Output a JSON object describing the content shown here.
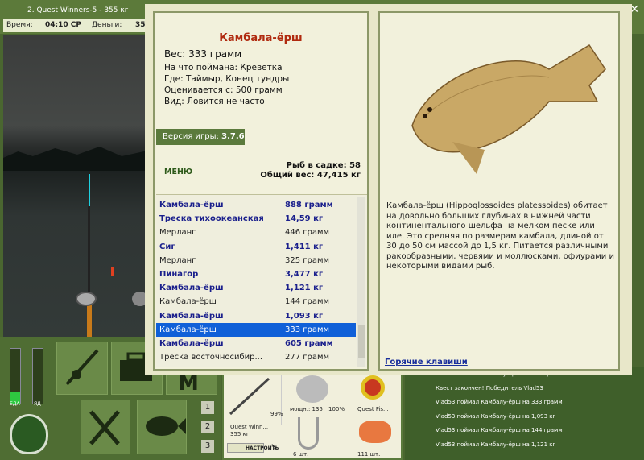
{
  "window_title": "2. Quest Winners-5 - 355 кг",
  "status": {
    "time_label": "Время:",
    "time_value": "04:10 СР",
    "money_label": "Деньги:",
    "money_value": "35"
  },
  "close_icon": "close-icon",
  "fish_card": {
    "name": "Камбала-ёрш",
    "weight": "Вес: 333 грамм",
    "caught_on": "На что поймана: Креветка",
    "where": "Где: Таймыр, Конец тундры",
    "value": "Оценивается с: 500 грамм",
    "kind": "Вид: Ловится не часто"
  },
  "version": {
    "label": "Версия игры:",
    "value": "3.7.6"
  },
  "menu_label": "МЕНЮ",
  "keepnet": {
    "count": "Рыб в садке: 58",
    "total": "Общий вес: 47,415 кг"
  },
  "fish_list": [
    {
      "name": "Камбала-ёрш",
      "weight": "888 грамм",
      "style": "bold"
    },
    {
      "name": "Треска тихоокеанская",
      "weight": "14,59 кг",
      "style": "bold"
    },
    {
      "name": "Мерланг",
      "weight": "446 грамм",
      "style": "plain"
    },
    {
      "name": "Сиг",
      "weight": "1,411 кг",
      "style": "bold"
    },
    {
      "name": "Мерланг",
      "weight": "325 грамм",
      "style": "plain"
    },
    {
      "name": "Пинагор",
      "weight": "3,477 кг",
      "style": "bold"
    },
    {
      "name": "Камбала-ёрш",
      "weight": "1,121 кг",
      "style": "bold"
    },
    {
      "name": "Камбала-ёрш",
      "weight": "144 грамм",
      "style": "plain"
    },
    {
      "name": "Камбала-ёрш",
      "weight": "1,093 кг",
      "style": "bold"
    },
    {
      "name": "Камбала-ёрш",
      "weight": "333 грамм",
      "style": "sel"
    },
    {
      "name": "Камбала-ёрш",
      "weight": "605 грамм",
      "style": "bold"
    },
    {
      "name": "Треска восточносибир...",
      "weight": "277 грамм",
      "style": "plain"
    }
  ],
  "description": "Камбала-ёрш (Hippoglossoides platessoides) обитает на довольно больших глубинах в нижней части континентального шельфа на мелком песке или иле. Это средняя по размерам камбала, длиной от 30 до 50 см массой до 1,5 кг. Питается различными ракообразными, червями и моллюсками, офиурами и некоторыми видами рыб.",
  "hotkeys_label": "Горячие клавиши",
  "bars": {
    "food_label": "ЕДА",
    "poison_label": "ЯД"
  },
  "slots": [
    "1",
    "2",
    "3"
  ],
  "inventory": {
    "rod_name": "Quest Winn...",
    "rod_weight": "355 кг",
    "rod_pct": "99%",
    "reel_power": "мощн.: 135",
    "reel_pct": "100%",
    "line_name": "Quest Fis...",
    "setup_button": "НАСТРОИТЬ",
    "hooks_count": "6 шт.",
    "bait_count": "111 шт."
  },
  "chat": [
    "Vlad53 поймал Камбалу-ёрш на 605 грамм",
    "Квест закончен! Победитель Vlad53",
    "Vlad53 поймал Камбалу-ёрш на 333 грамм",
    "Vlad53 поймал Камбалу-ёрш на 1,093 кг",
    "Vlad53 поймал Камбалу-ёрш на 144 грамм",
    "Vlad53 поймал Камбалу-ёрш на 1,121 кг"
  ]
}
